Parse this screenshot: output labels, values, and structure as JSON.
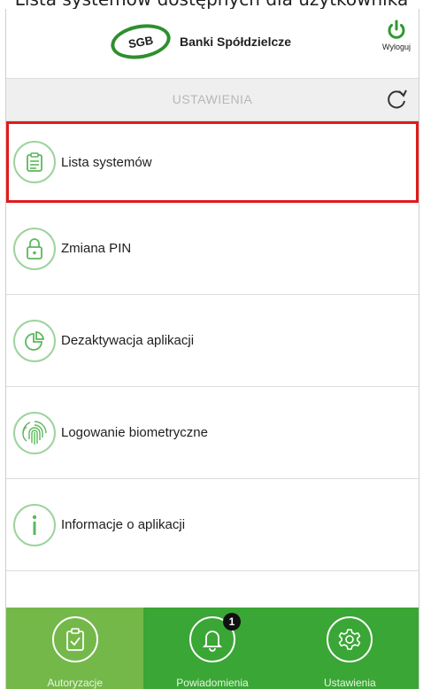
{
  "caption": "Lista systemów dostępnych dla użytkownika",
  "header": {
    "logo_badge": "SGB",
    "logo_text": "Banki Spółdzielcze",
    "logout_label": "Wyloguj"
  },
  "titlebar": {
    "title": "USTAWIENIA"
  },
  "menu": {
    "items": [
      {
        "label": "Lista systemów",
        "icon": "clipboard-icon"
      },
      {
        "label": "Zmiana PIN",
        "icon": "lock-icon"
      },
      {
        "label": "Dezaktywacja aplikacji",
        "icon": "pie-chart-icon"
      },
      {
        "label": "Logowanie biometryczne",
        "icon": "fingerprint-icon"
      },
      {
        "label": "Informacje o aplikacji",
        "icon": "info-icon"
      }
    ]
  },
  "bottom_nav": {
    "tabs": [
      {
        "label": "Autoryzacje",
        "icon": "clipboard-check-icon"
      },
      {
        "label": "Powiadomienia",
        "icon": "bell-icon",
        "badge": "1"
      },
      {
        "label": "Ustawienia",
        "icon": "gear-icon"
      }
    ]
  },
  "colors": {
    "accent": "#3aa635",
    "active_tab": "#74b84a",
    "selection": "#e01b1b",
    "icon_ring": "#9ed39e"
  }
}
